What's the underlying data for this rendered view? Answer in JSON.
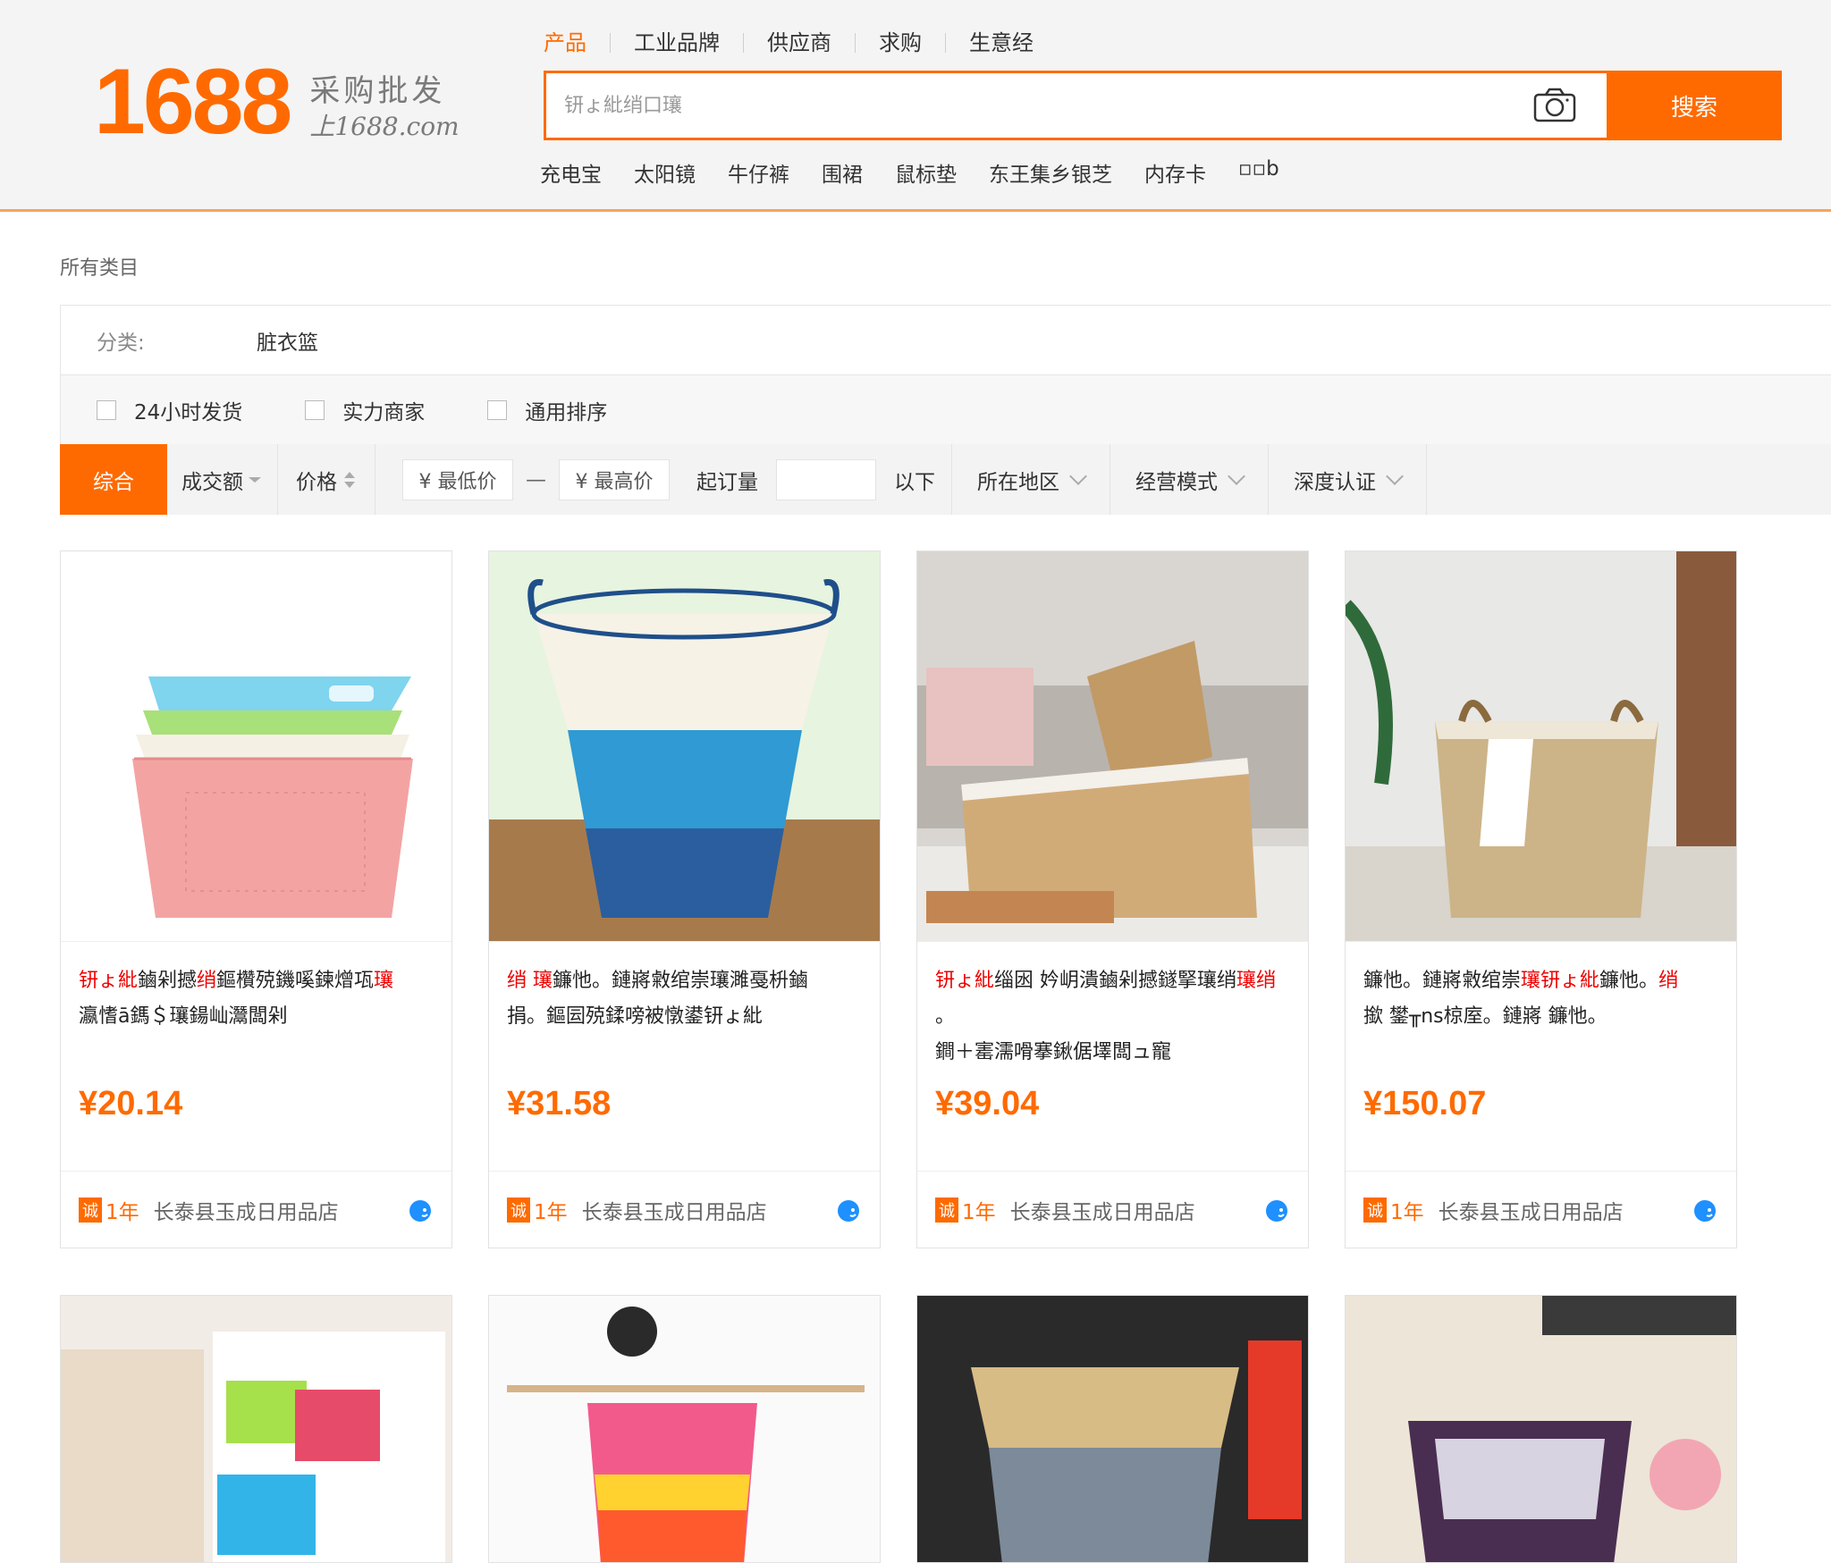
{
  "logo": {
    "number": "1688",
    "tagline": "采购批发",
    "domain": "上1688.com"
  },
  "nav": [
    "产品",
    "工业品牌",
    "供应商",
    "求购",
    "生意经"
  ],
  "search": {
    "placeholder": "钘ょ紕绡口瓖",
    "button": "搜索"
  },
  "hotwords": [
    "充电宝",
    "太阳镜",
    "牛仔裤",
    "围裙",
    "鼠标垫",
    "东王集乡银芝",
    "内存卡",
    "▫▫b"
  ],
  "breadcrumb": "所有类目",
  "category": {
    "label": "分类:",
    "value": "脏衣篮"
  },
  "checks": [
    "24小时发货",
    "实力商家",
    "通用排序"
  ],
  "sortbar": {
    "active": "综合",
    "volume": "成交额",
    "price": "价格",
    "min_price": "¥ 最低价",
    "dash": "—",
    "max_price": "¥ 最高价",
    "moq": "起订量",
    "below": "以下",
    "region": "所在地区",
    "mode": "经营模式",
    "cert": "深度认证"
  },
  "products": [
    {
      "title_line1_pre": "钘ょ紕",
      "title_line1_mid": "鏀剁撼",
      "title_line1_post": "鏂欑殑鐖嗘鍊熷瓨",
      "title_line2": "瀛愭ā鎷＄瓖鍚屾灊闆剁",
      "price": "¥20.14",
      "years": "1年",
      "shop": "长泰县玉成日用品店"
    },
    {
      "title_line1_pre": "绡 ",
      "title_line1_mid": "瓖",
      "title_line1_post": "鐮忚。鏈嶈敹绾崇瓖濉戞枡鏀",
      "title_line2": "捐。鏂囩殑鍒嗙被憞鍙钘ょ紕",
      "price": "¥31.58",
      "years": "1年",
      "shop": "长泰县玉成日用品店"
    },
    {
      "title_line1_pre": "钘ょ紕",
      "title_line1_mid": "缁囦",
      "title_line1_post": " 妗岄潰鏀剁撼鐩掔瓖绡",
      "title_line2": "鐧＋寚濡嗗搴鍬倨墿闆ュ寵",
      "price": "¥39.04",
      "years": "1年",
      "shop": "长泰县玉成日用品店"
    },
    {
      "title_line1_pre": "鐮忚。",
      "title_line1_mid": "鏈嶈敹绾崇",
      "title_line1_post": "瓖钘ょ紕鐮忚。绡",
      "title_line2": "撳 鐢╥ns椋庢。鏈嶈 鐮忚。",
      "price": "¥150.07",
      "years": "1年",
      "shop": "长泰县玉成日用品店"
    }
  ],
  "badge": "诚",
  "colors": {
    "accent": "#ff6a00",
    "highlight": "#e00000"
  },
  "icons": [
    "camera-icon",
    "wangwang-icon"
  ]
}
